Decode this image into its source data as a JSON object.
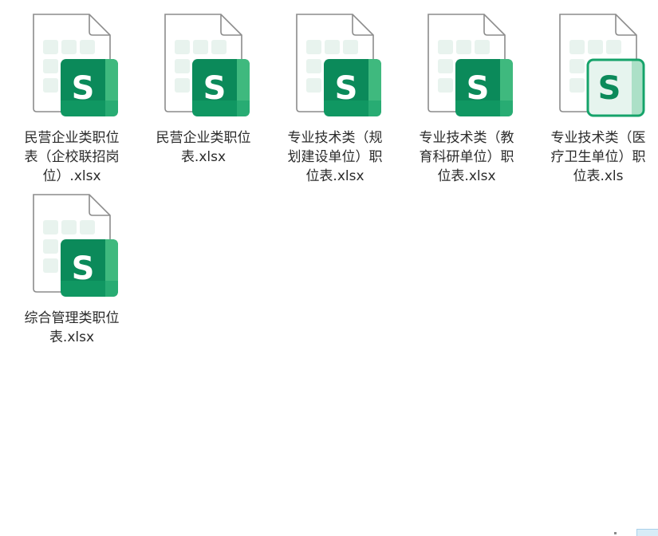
{
  "files": [
    {
      "name": "民营企业类职位表（企校联招岗位）.xlsx",
      "icon": "wps-spreadsheet-icon",
      "variant": "solid"
    },
    {
      "name": "民营企业类职位表.xlsx",
      "icon": "wps-spreadsheet-icon",
      "variant": "solid"
    },
    {
      "name": "专业技术类（规划建设单位）职位表.xlsx",
      "icon": "wps-spreadsheet-icon",
      "variant": "solid"
    },
    {
      "name": "专业技术类（教育科研单位）职位表.xlsx",
      "icon": "wps-spreadsheet-icon",
      "variant": "solid"
    },
    {
      "name": "专业技术类（医疗卫生单位）职位表.xls",
      "icon": "wps-spreadsheet-icon",
      "variant": "outline"
    },
    {
      "name": "综合管理类职位表.xlsx",
      "icon": "wps-spreadsheet-icon",
      "variant": "solid"
    }
  ],
  "icon_letter": "S",
  "colors": {
    "badge_dark": "#0b8a5a",
    "badge_mid": "#15a36a",
    "badge_light": "#3fb97e",
    "badge_outline_fill": "#e6f4ee",
    "page_outline": "#8c8c8c",
    "cell_tint": "#e8f3ee"
  }
}
